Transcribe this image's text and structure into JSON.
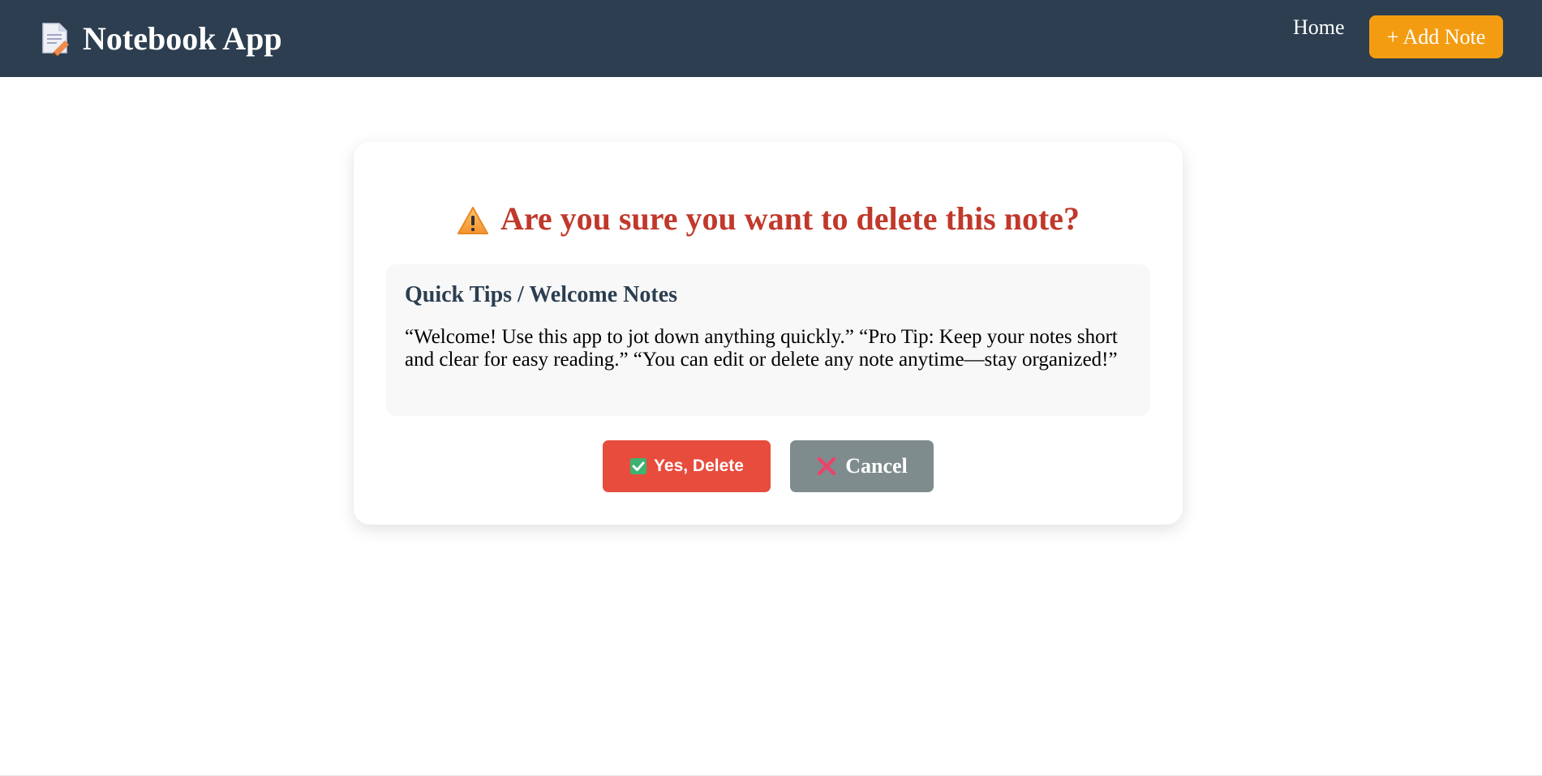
{
  "app": {
    "title": "Notebook App",
    "logo_icon": "notepad-pencil-icon"
  },
  "nav": {
    "home_label": "Home",
    "add_note_label": "+ Add Note"
  },
  "dialog": {
    "warning_icon": "warning-icon",
    "title": "Are you sure you want to delete this note?",
    "note": {
      "title": "Quick Tips / Welcome Notes",
      "body": "“Welcome! Use this app to jot down anything quickly.” “Pro Tip: Keep your notes short and clear for easy reading.” “You can edit or delete any note anytime—stay organized!”"
    },
    "confirm_button": {
      "icon": "check-box-icon",
      "label": "Yes, Delete"
    },
    "cancel_button": {
      "icon": "cross-mark-icon",
      "label": "Cancel"
    }
  },
  "colors": {
    "navbar": "#2c3e50",
    "accent": "#f39c12",
    "danger": "#e74c3c",
    "title_red": "#c0392b",
    "cancel_gray": "#7f8c8d"
  }
}
